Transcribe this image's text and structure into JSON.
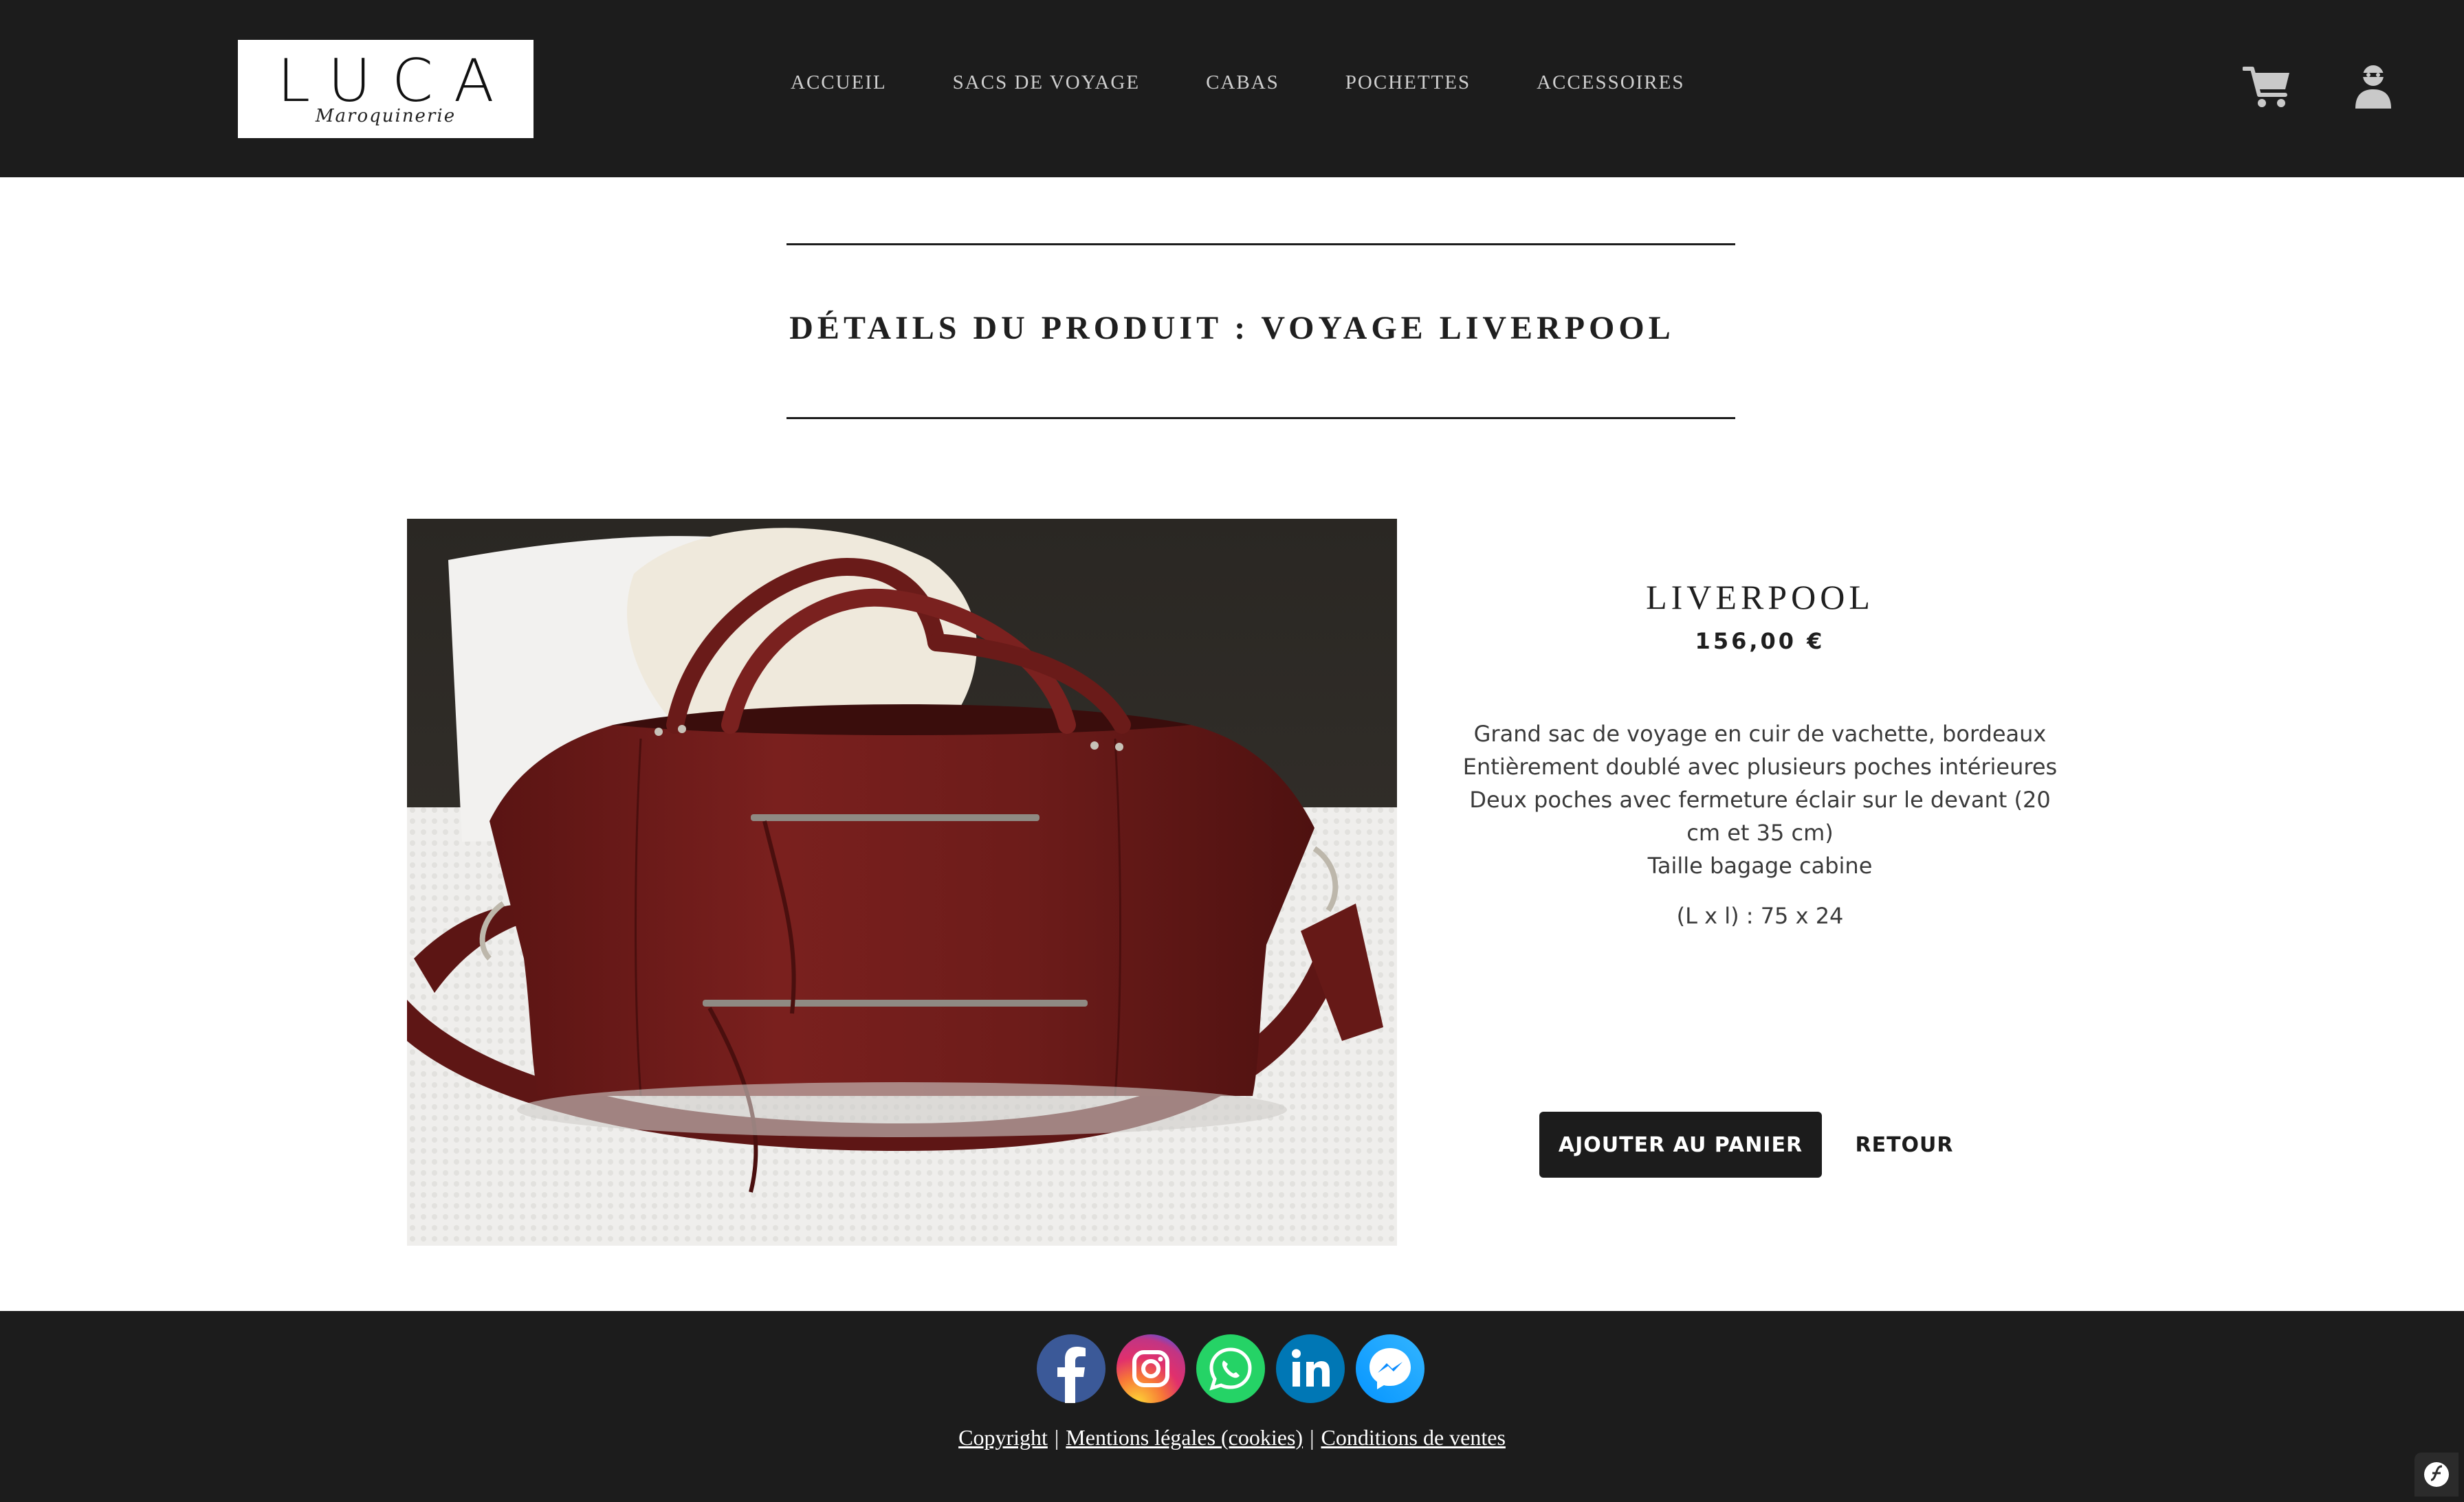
{
  "header": {
    "logo": {
      "word": "LUCA",
      "script": "Maroquinerie"
    },
    "nav": [
      {
        "label": "Accueil"
      },
      {
        "label": "Sacs de voyage"
      },
      {
        "label": "Cabas"
      },
      {
        "label": "Pochettes"
      },
      {
        "label": "Accessoires"
      }
    ],
    "cart_icon": "shopping-cart-icon",
    "user_icon": "user-icon"
  },
  "page": {
    "title": "DÉTAILS DU PRODUIT : VOYAGE LIVERPOOL"
  },
  "product": {
    "image_alt": "Sac de voyage Liverpool en cuir bordeaux",
    "name": "LIVERPOOL",
    "price": "156,00 €",
    "description_lines": [
      "Grand sac de voyage en cuir de vachette, bordeaux",
      "Entièrement doublé avec plusieurs poches intérieures",
      "Deux poches avec fermeture éclair sur le devant (20 cm et 35 cm)",
      "Taille bagage cabine"
    ],
    "dimensions": "(L x l) : 75 x 24",
    "add_to_cart_label": "AJOUTER AU PANIER",
    "back_label": "RETOUR"
  },
  "footer": {
    "social": [
      "facebook-icon",
      "instagram-icon",
      "whatsapp-icon",
      "linkedin-icon",
      "messenger-icon"
    ],
    "links": [
      {
        "label": "Copyright"
      },
      {
        "label": "Mentions légales (cookies)"
      },
      {
        "label": "Conditions de ventes"
      }
    ],
    "separator": "|"
  },
  "colors": {
    "header_bg": "#1c1c1c",
    "nav_text": "#cfcfcf",
    "button_bg": "#1c1c1c",
    "leather": "#6e1a19"
  }
}
